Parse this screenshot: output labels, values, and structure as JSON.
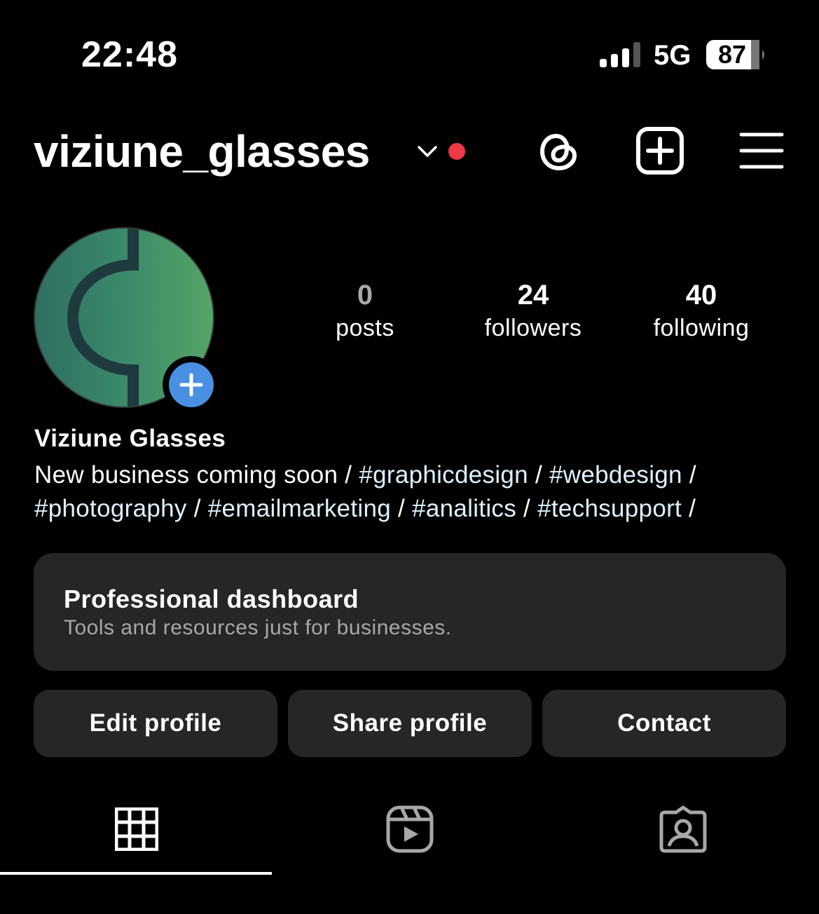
{
  "status_bar": {
    "time": "22:48",
    "network": "5G",
    "battery": "87",
    "icons": [
      "signal-icon",
      "battery-icon"
    ]
  },
  "header": {
    "username": "viziune_glasses",
    "has_notification_dot": true,
    "icons": [
      "chevron-down-icon",
      "threads-icon",
      "create-post-icon",
      "menu-icon"
    ]
  },
  "profile": {
    "avatar_icon": "avatar-logo-icon",
    "stats": [
      {
        "value": "0",
        "label": "posts"
      },
      {
        "value": "24",
        "label": "followers"
      },
      {
        "value": "40",
        "label": "following"
      }
    ],
    "display_name": "Viziune Glasses",
    "bio_line1_prefix": "New business coming soon / ",
    "bio_tag1": "#graphicdesign",
    "bio_sep1": " / ",
    "bio_tag2": "#webdesign",
    "bio_sep2": " /",
    "bio_tag3": "#photography",
    "bio_sep3": " / ",
    "bio_tag4": "#emailmarketing",
    "bio_sep4": " / ",
    "bio_tag5": "#analitics",
    "bio_sep5": " / ",
    "bio_tag6": "#techsupport",
    "bio_sep6": " /"
  },
  "dashboard": {
    "title": "Professional dashboard",
    "subtitle": "Tools and resources just for businesses."
  },
  "actions": {
    "edit_label": "Edit profile",
    "share_label": "Share profile",
    "contact_label": "Contact"
  },
  "tabs": [
    {
      "icon": "grid-icon",
      "active": true
    },
    {
      "icon": "reels-icon",
      "active": false
    },
    {
      "icon": "tagged-icon",
      "active": false
    }
  ],
  "colors": {
    "background": "#000000",
    "card": "#262626",
    "accent_blue": "#4a90e2",
    "notification_red": "#ed3a44",
    "muted_text": "#a8a8a8",
    "hashtag": "#e0f1ff"
  }
}
